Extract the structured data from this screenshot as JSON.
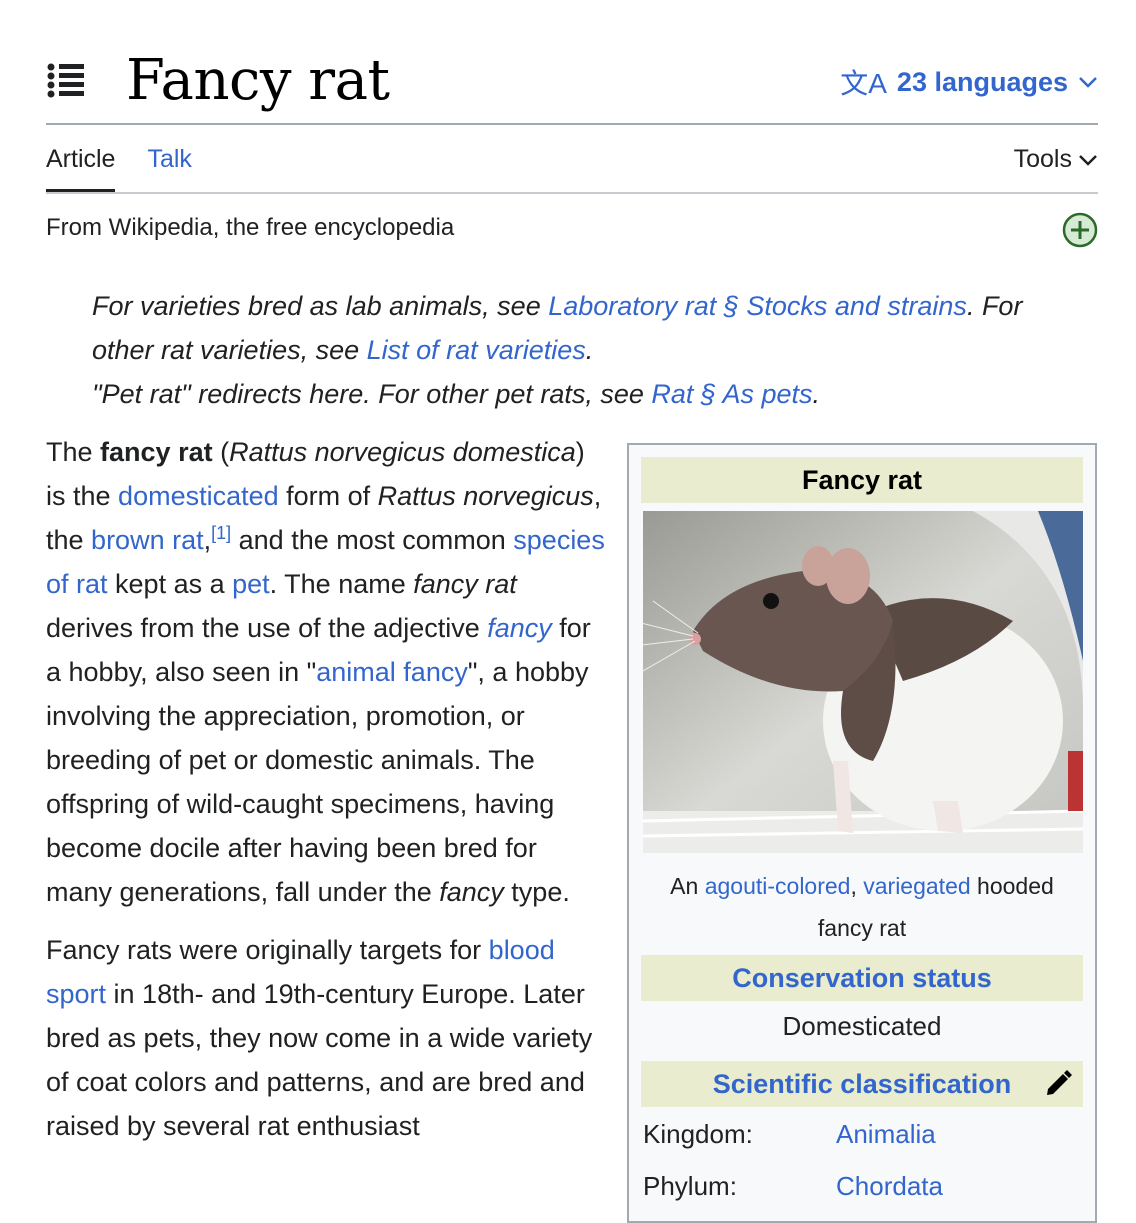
{
  "header": {
    "title": "Fancy rat",
    "languages_label": "23 languages"
  },
  "tabs": [
    {
      "label": "Article"
    },
    {
      "label": "Talk"
    }
  ],
  "tools_label": "Tools",
  "tagline": "From Wikipedia, the free encyclopedia",
  "hatnote": {
    "l1_a": "For varieties bred as lab animals, see ",
    "l1_link": "Laboratory rat § Stocks and strains",
    "l1_b": ". For other rat varieties, see ",
    "l1_link2": "List of rat varieties",
    "l1_c": ".",
    "l2_a": "\"Pet rat\" redirects here. For other pet rats, see ",
    "l2_link": "Rat § As pets",
    "l2_b": "."
  },
  "para1": {
    "t1": "The ",
    "b1": "fancy rat",
    "t2": " (",
    "i1": "Rattus norvegicus domestica",
    "t3": ") is the ",
    "a1": "domesticated",
    "t4": " form of ",
    "i2": "Rattus norvegicus",
    "t5": ", the ",
    "a2": "brown rat",
    "t6": ",",
    "ref1": "[1]",
    "t7": " and the most common ",
    "a3": "species of rat",
    "t8": " kept as a ",
    "a4": "pet",
    "t9": ". The name ",
    "i3": "fancy rat",
    "t10": " derives from the use of the adjective ",
    "a5": "fancy",
    "t11": " for a hobby, also seen in \"",
    "a6": "animal fancy",
    "t12": "\", a hobby involving the appreciation, promotion, or breeding of pet or domestic animals. The offspring of wild-caught specimens, having become docile after having been bred for many generations, fall under the ",
    "i4": "fancy",
    "t13": " type."
  },
  "para2": {
    "t1": "Fancy rats were originally targets for ",
    "a1": "blood sport",
    "t2": " in 18th- and 19th-century Europe. Later bred as pets, they now come in a wide variety of coat colors and patterns, and are bred and raised by several rat enthusiast"
  },
  "infobox": {
    "title": "Fancy rat",
    "caption_a": "An ",
    "caption_link1": "agouti-colored",
    "caption_b": ", ",
    "caption_link2": "variegated",
    "caption_c": " hooded fancy rat",
    "conservation_header": "Conservation status",
    "conservation_value": "Domesticated",
    "scientific_header": "Scientific classification",
    "rows": [
      {
        "key": "Kingdom:",
        "value": "Animalia"
      },
      {
        "key": "Phylum:",
        "value": "Chordata"
      }
    ]
  },
  "colors": {
    "link": "#3366cc",
    "infobox_header": "#eaecd0",
    "add_icon": "#2a6b2a"
  }
}
